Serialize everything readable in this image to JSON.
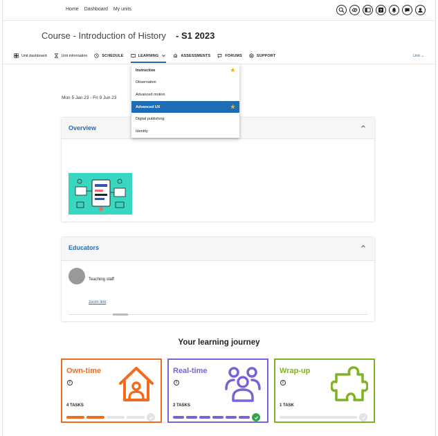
{
  "topnav": {
    "home": "Home",
    "dashboard": "Dashboard",
    "my_units": "My units"
  },
  "top_icons": [
    "zoom-icon",
    "link-icon",
    "sidebar-icon",
    "help-icon",
    "bell-icon",
    "chat-icon",
    "user-icon"
  ],
  "course": {
    "title": "Course - Introduction of History",
    "term": "- S1 2023"
  },
  "tabs": [
    {
      "label": "Unit dashboard"
    },
    {
      "label": "Unit information"
    },
    {
      "label": "SCHEDULE"
    },
    {
      "label": "LEARNING"
    },
    {
      "label": "ASSESSMENTS"
    },
    {
      "label": "FORUMS"
    },
    {
      "label": "SUPPORT"
    }
  ],
  "unit_menu": "Unit",
  "learning_menu": {
    "items": [
      {
        "label": "Instruction",
        "starred": true
      },
      {
        "label": "Observation",
        "starred": false
      },
      {
        "label": "Advanced motion",
        "starred": false
      },
      {
        "label": "Advanced UX",
        "starred": true,
        "selected": true
      },
      {
        "label": "Digital publishing",
        "starred": false
      },
      {
        "label": "Identity",
        "starred": false
      }
    ]
  },
  "dates": "Mon 5 Jan 23 - Fri 9 Jun 23",
  "overview": {
    "title": "Overview"
  },
  "educators": {
    "title": "Educators",
    "staff_label": "Teaching staff",
    "zoom_link": "zoom link"
  },
  "journey": {
    "title": "Your learning journey",
    "cards": [
      {
        "name": "Own-time",
        "tasks": "4 TASKS",
        "color": "#f26b1d",
        "completed": 2,
        "total": 4,
        "done": false
      },
      {
        "name": "Real-time",
        "tasks": "2 TASKS",
        "color": "#7b61d6",
        "completed": 6,
        "total": 6,
        "done": true
      },
      {
        "name": "Wrap-up",
        "tasks": "1 TASK",
        "color": "#7fb224",
        "completed": 0,
        "total": 1,
        "done": false
      }
    ]
  }
}
